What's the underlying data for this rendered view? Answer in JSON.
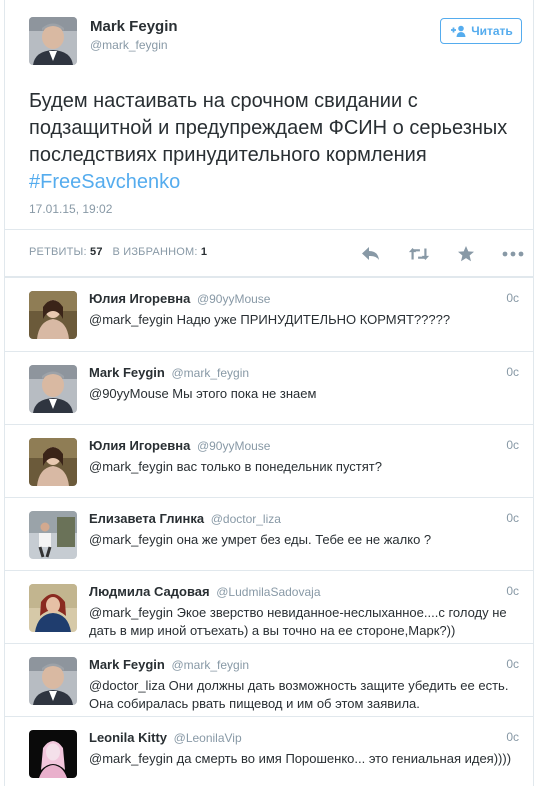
{
  "tweet": {
    "author_name": "Mark Feygin",
    "author_handle": "@mark_feygin",
    "follow_label": "Читать",
    "text": "Будем настаивать на срочном свидании с подзащитной и предупреждаем ФСИН о серьезных последствиях принудительного кормления ",
    "hashtag": "#FreeSavchenko",
    "date": "17.01.15, 19:02",
    "retweets_label": "РЕТВИТЫ:",
    "retweets_count": "57",
    "favorites_label": "В ИЗБРАННОМ:",
    "favorites_count": "1",
    "icons": {
      "follow": "add-user-icon",
      "reply": "reply-icon",
      "retweet": "retweet-icon",
      "favorite": "star-icon",
      "more": "more-icon"
    }
  },
  "colors": {
    "accent": "#55acee",
    "secondary_text": "#8899a6",
    "primary_text": "#292f33",
    "divider": "#e1e8ed"
  },
  "replies": [
    {
      "name": "Юлия Игоревна",
      "handle": "@90yyMouse",
      "time": "0с",
      "text": "@mark_feygin Надю уже ПРИНУДИТЕЛЬНО КОРМЯТ?????"
    },
    {
      "name": "Mark Feygin",
      "handle": "@mark_feygin",
      "time": "0с",
      "text": "@90yyMouse Мы этого пока не знаем"
    },
    {
      "name": "Юлия Игоревна",
      "handle": "@90yyMouse",
      "time": "0с",
      "text": "@mark_feygin вас только в понедельник пустят?"
    },
    {
      "name": "Елизавета Глинка",
      "handle": "@doctor_liza",
      "time": "0с",
      "text": "@mark_feygin она же умрет без еды. Тебе ее не жалко ?"
    },
    {
      "name": "Людмила Садовая",
      "handle": "@LudmilaSadovaja",
      "time": "0с",
      "text": "@mark_feygin Экое зверство невиданное-неслыханное....с голоду не дать в мир иной отъехать) а вы точно на ее стороне,Марк?))"
    },
    {
      "name": "Mark Feygin",
      "handle": "@mark_feygin",
      "time": "0с",
      "text": "@doctor_liza Они должны дать возможность защите убедить ее есть. Она собиралась рвать пищевод и им об этом заявила."
    },
    {
      "name": "Leonila Kitty",
      "handle": "@LeonilaVip",
      "time": "0с",
      "text": "@mark_feygin да смерть во имя Порошенко... это гениальная идея))))"
    }
  ]
}
